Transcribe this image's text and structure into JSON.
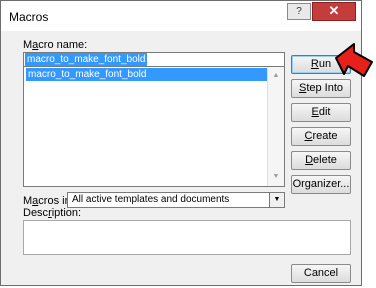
{
  "dialog": {
    "title": "Macros"
  },
  "titlebar": {
    "help_glyph": "?",
    "close_glyph": "✕"
  },
  "macro_name": {
    "label_prefix": "M",
    "label_access": "a",
    "label_suffix": "cro name:",
    "value": "macro_to_make_font_bold",
    "list_items": [
      "macro_to_make_font_bold"
    ],
    "selected_index": 0
  },
  "buttons": {
    "run": {
      "access": "R",
      "rest": "un"
    },
    "step_into": {
      "access": "S",
      "rest": "tep Into"
    },
    "edit": {
      "access": "E",
      "rest": "dit"
    },
    "create": {
      "access": "C",
      "rest": "reate"
    },
    "delete": {
      "access": "D",
      "rest": "elete"
    },
    "organizer": {
      "label": "Organizer..."
    },
    "cancel": {
      "label": "Cancel"
    }
  },
  "macros_in": {
    "label_prefix": "M",
    "label_access": "a",
    "label_suffix": "cros in:",
    "value": "All active templates and documents"
  },
  "description": {
    "label_prefix": "Desc",
    "label_access": "r",
    "label_suffix": "iption:"
  },
  "colors": {
    "accent": "#3399ff",
    "arrow": "#e8201c",
    "close": "#c43c3c"
  },
  "icons": [
    "help-icon",
    "close-icon",
    "scroll-up-icon",
    "scroll-down-icon",
    "dropdown-icon",
    "pointer-arrow-icon"
  ]
}
